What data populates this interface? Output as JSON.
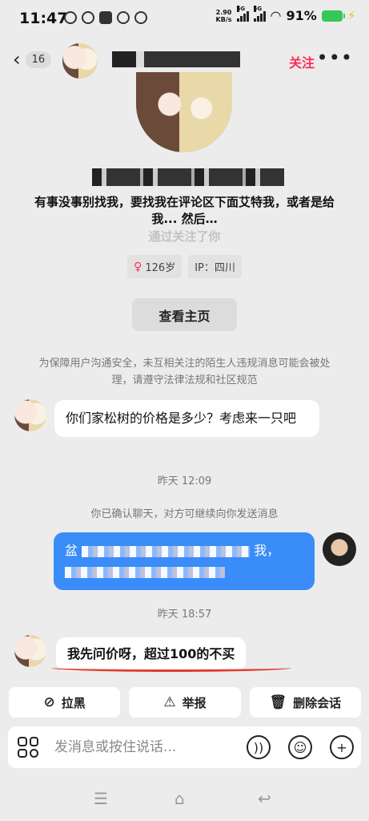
{
  "status_bar": {
    "time": "11:47",
    "net_speed_value": "2.90",
    "net_speed_unit": "KB/s",
    "signal1_label": "5G",
    "signal2_label": "5G",
    "battery_percent": "91%",
    "icons": [
      "wechat-icon",
      "wechat-icon",
      "app-icon",
      "alert-icon",
      "wechat-icon"
    ]
  },
  "header": {
    "unread_count": "16",
    "follow_label": "关注",
    "more_label": "•••"
  },
  "profile": {
    "bio": "有事没事别找我，要找我在评论区下面艾特我，或者是给我... 然后…",
    "follows_text": "通过关注了你",
    "age_tag": "126岁",
    "ip_tag": "IP：四川",
    "view_home_label": "查看主页"
  },
  "notice": "为保障用户沟通安全，未互相关注的陌生人违规消息可能会被处理，请遵守法律法规和社区规范",
  "messages": {
    "m1": "你们家松树的价格是多少？考虑来一只吧",
    "ts1": "昨天 12:09",
    "confirm_note": "你已确认聊天，对方可继续向你发送消息",
    "m2_prefix": "盆",
    "m2_suffix": "我，",
    "ts2": "昨天 18:57",
    "m3": "我先问价呀，超过100的不买"
  },
  "actions": {
    "block": "拉黑",
    "report": "举报",
    "delete": "删除会话"
  },
  "input": {
    "placeholder": "发消息或按住说话..."
  }
}
